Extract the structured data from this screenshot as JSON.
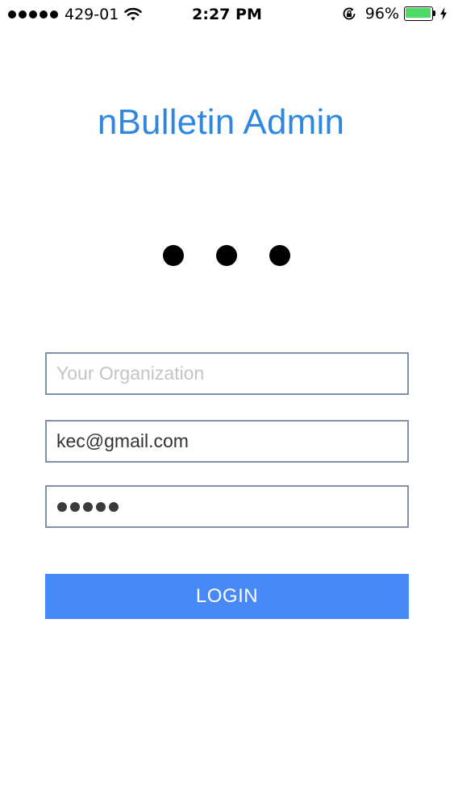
{
  "status_bar": {
    "signal_bars": 5,
    "carrier": "429-01",
    "wifi_icon": "wifi-icon",
    "time": "2:27 PM",
    "rotation_lock_icon": "rotation-lock-icon",
    "battery_percent": "96%",
    "battery_level": 0.96,
    "battery_color": "#4cd964",
    "charging_icon": "charging-bolt-icon"
  },
  "app": {
    "title": "nBulletin Admin",
    "title_color": "#2f87e0",
    "loading_indicator": "loading-dots-icon"
  },
  "form": {
    "organization": {
      "value": "",
      "placeholder": "Your Organization"
    },
    "email": {
      "value": "kec@gmail.com",
      "placeholder": ""
    },
    "password": {
      "masked_length": 5
    },
    "login_label": "LOGIN",
    "login_color": "#4889f8"
  }
}
